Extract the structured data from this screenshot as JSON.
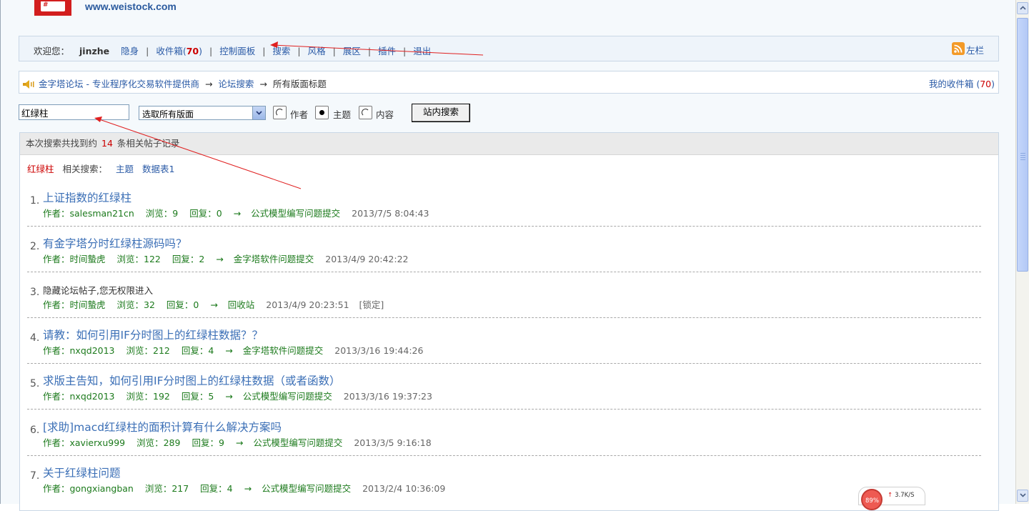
{
  "header": {
    "logo_icon": "forum-logo-icon",
    "logo_text": "#",
    "site_url": "www.weistock.com"
  },
  "welcome": {
    "label": "欢迎您：",
    "username": "jinzhe",
    "invisible": "隐身",
    "inbox_label": "收件箱",
    "inbox_count": "70",
    "control_panel": "控制面板",
    "search": "搜索",
    "style": "风格",
    "exhibit": "展区",
    "plugins": "插件",
    "logout": "退出",
    "sidebar_toggle": "左栏",
    "rss_icon": "rss-icon"
  },
  "breadcrumb": {
    "icon": "speaker-icon",
    "home": "金字塔论坛 - 专业程序化交易软件提供商",
    "search": "论坛搜索",
    "current": "所有版面标题",
    "arrow": "→",
    "my_inbox": "我的收件箱",
    "my_inbox_count": "70"
  },
  "search_form": {
    "keyword": "红绿柱",
    "forum_selected": "选取所有版面",
    "radio_author": "作者",
    "radio_topic": "主题",
    "radio_content": "内容",
    "selected_radio": "topic",
    "submit": "站内搜索"
  },
  "results": {
    "summary_prefix": "本次搜索共找到约",
    "summary_count": "14",
    "summary_suffix": "条相关帖子记录",
    "related_keyword": "红绿柱",
    "related_label": "相关搜索：",
    "related_links": [
      "主题",
      "数据表1"
    ],
    "items": [
      {
        "idx": "1.",
        "title": "上证指数的红绿柱",
        "author": "作者：salesman21cn",
        "views": "浏览：9",
        "replies": "回复：0",
        "forum": "公式模型编写问题提交",
        "date": "2013/7/5 8:04:43",
        "lock": ""
      },
      {
        "idx": "2.",
        "title": "有金字塔分时红绿柱源码吗？",
        "author": "作者：时间蟄虎",
        "views": "浏览：122",
        "replies": "回复：2",
        "forum": "金字塔软件问题提交",
        "date": "2013/4/9 20:42:22",
        "lock": ""
      },
      {
        "idx": "3.",
        "title": "隐藏论坛帖子,您无权限进入",
        "author": "作者：时间蟄虎",
        "views": "浏览：32",
        "replies": "回复：0",
        "forum": "回收站",
        "date": "2013/4/9 20:23:51",
        "lock": "[锁定]"
      },
      {
        "idx": "4.",
        "title": "请教：如何引用IF分时图上的红绿柱数据？？",
        "author": "作者：nxqd2013",
        "views": "浏览：212",
        "replies": "回复：4",
        "forum": "金字塔软件问题提交",
        "date": "2013/3/16 19:44:26",
        "lock": ""
      },
      {
        "idx": "5.",
        "title": "求版主告知，如何引用IF分时图上的红绿柱数据（或者函数）",
        "author": "作者：nxqd2013",
        "views": "浏览：192",
        "replies": "回复：5",
        "forum": "公式模型编写问题提交",
        "date": "2013/3/16 19:37:23",
        "lock": ""
      },
      {
        "idx": "6.",
        "title": "[求助]macd红绿柱的面积计算有什么解决方案吗",
        "author": "作者：xavierxu999",
        "views": "浏览：289",
        "replies": "回复：9",
        "forum": "公式模型编写问题提交",
        "date": "2013/3/5 9:16:18",
        "lock": ""
      },
      {
        "idx": "7.",
        "title": "关于红绿柱问题",
        "author": "作者：gongxiangban",
        "views": "浏览：217",
        "replies": "回复：4",
        "forum": "公式模型编写问题提交",
        "date": "2013/2/4 10:36:09",
        "lock": ""
      }
    ]
  },
  "net_widget": {
    "percent": "89%",
    "speed": "3.7K/S",
    "up_icon": "arrow-up-icon"
  },
  "colors": {
    "link": "#2a5aa6",
    "accent_red": "#cc0000",
    "meta_green": "#1c7a1c"
  }
}
